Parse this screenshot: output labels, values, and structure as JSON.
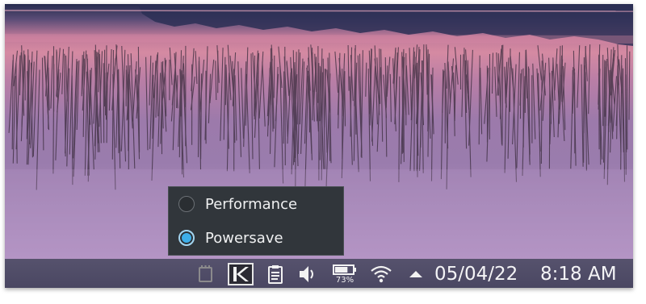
{
  "desktop": {
    "popup": {
      "items": [
        {
          "label": "Performance",
          "selected": false
        },
        {
          "label": "Powersave",
          "selected": true
        }
      ],
      "accent_color": "#3daee9"
    },
    "panel": {
      "tray_icons": [
        "memory-chip-icon",
        "kde-connect-icon",
        "clipboard-icon",
        "volume-icon",
        "battery-icon",
        "wifi-icon",
        "expand-tray-arrow-icon"
      ],
      "battery_percent": "73%",
      "date": "05/04/22",
      "time": "8:18 AM"
    }
  }
}
